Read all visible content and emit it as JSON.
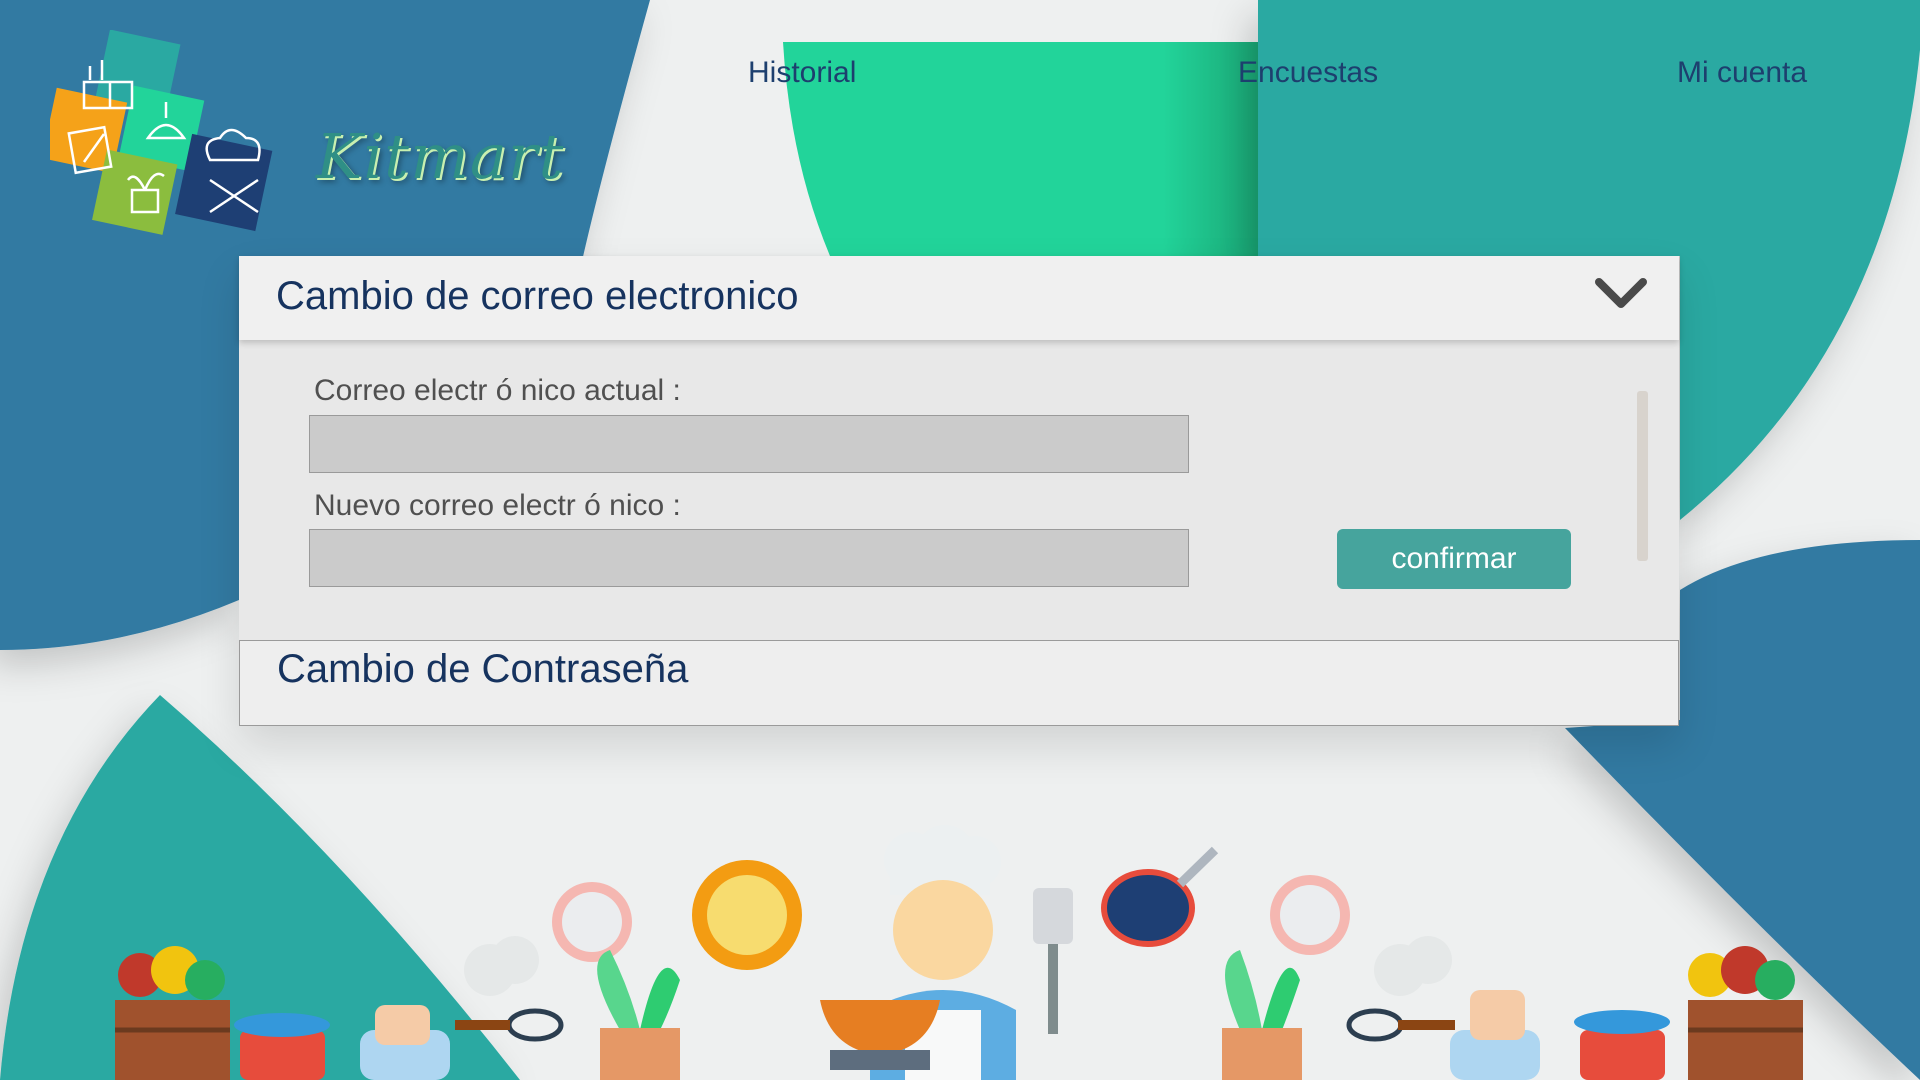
{
  "brand": {
    "name": "Kitmart"
  },
  "nav": {
    "items": [
      {
        "label": "Historial"
      },
      {
        "label": "Encuestas"
      },
      {
        "label": "Mi cuenta"
      }
    ]
  },
  "email_section": {
    "title": "Cambio de correo electronico",
    "expanded": true,
    "current_label": "Correo electr ó nico actual :",
    "current_value": "",
    "new_label": "Nuevo correo electr ó nico :",
    "new_value": "",
    "confirm_label": "confirmar"
  },
  "password_section": {
    "title": "Cambio de Contraseña",
    "expanded": false
  },
  "colors": {
    "dark_blue": "#337aa2",
    "teal": "#2aa9a2",
    "green": "#22d49a",
    "button": "#46a49d",
    "title_text": "#16335f"
  },
  "icons": [
    "kitchen-icon",
    "lamp-icon",
    "chef-hat-icon",
    "notepad-icon",
    "plant-icon",
    "chevron-down-icon"
  ]
}
